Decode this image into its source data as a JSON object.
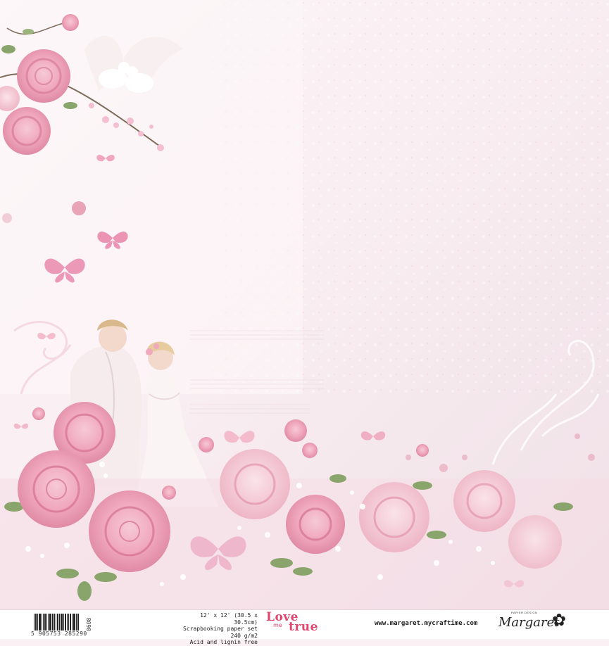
{
  "footer": {
    "barcode_number": "5 905753 285290",
    "product_code": "0608",
    "specs": {
      "line1": "12' x 12' (30.5 x 30.5cm)",
      "line2": "Scrapbooking paper set 240 g/m2",
      "line3": "Acid and lignin free"
    },
    "collection": {
      "word1": "Love",
      "word2": "me",
      "word3": "true"
    },
    "website": "www.margaret.mycraftime.com",
    "brand": {
      "pretitle": "PAPIER DESIGN",
      "name": "Margaret",
      "flower_icon": "flower-icon"
    }
  },
  "colors": {
    "accent": "#e0466e",
    "rose": "#f2a7bd",
    "rose_dark": "#d76b8d",
    "background": "#fbf1f4"
  }
}
